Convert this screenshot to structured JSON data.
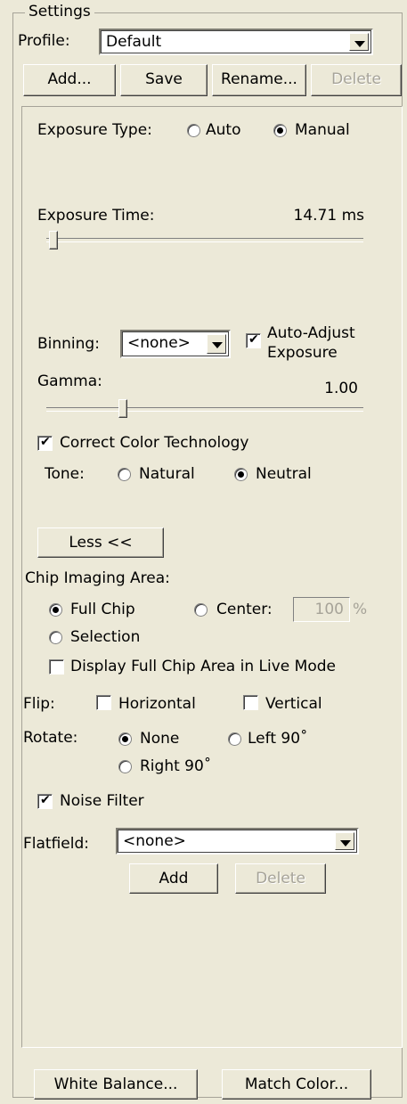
{
  "settings": {
    "group_title": "Settings",
    "profile_label": "Profile:",
    "profile_value": "Default",
    "buttons": {
      "add": "Add...",
      "save": "Save",
      "rename": "Rename...",
      "delete": "Delete"
    }
  },
  "exposure": {
    "type_label": "Exposure Type:",
    "auto_label": "Auto",
    "manual_label": "Manual",
    "selected": "Manual",
    "time_label": "Exposure Time:",
    "time_value": "14.71 ms",
    "time_slider_level": 0.02
  },
  "binning": {
    "label": "Binning:",
    "value": "<none>",
    "auto_adjust_label_1": "Auto-Adjust",
    "auto_adjust_label_2": "Exposure",
    "auto_adjust_checked": true
  },
  "gamma": {
    "label": "Gamma:",
    "value": "1.00",
    "slider_level": 0.25
  },
  "color": {
    "correct_label": "Correct Color Technology",
    "correct_checked": true,
    "tone_label": "Tone:",
    "natural_label": "Natural",
    "neutral_label": "Neutral",
    "selected": "Neutral"
  },
  "less_button": "Less <<",
  "chip": {
    "area_label": "Chip Imaging Area:",
    "full_chip_label": "Full Chip",
    "center_label": "Center:",
    "center_value": "100",
    "percent": "%",
    "selection_label": "Selection",
    "selected": "Full Chip",
    "display_full_label": "Display Full Chip Area in Live Mode",
    "display_full_checked": false
  },
  "flip": {
    "label": "Flip:",
    "horizontal_label": "Horizontal",
    "vertical_label": "Vertical"
  },
  "rotate": {
    "label": "Rotate:",
    "none_label": "None",
    "left_label": "Left 90˚",
    "right_label": "Right 90˚",
    "selected": "None"
  },
  "noise": {
    "label": "Noise Filter",
    "checked": true
  },
  "flatfield": {
    "label": "Flatfield:",
    "value": "<none>",
    "add": "Add",
    "delete": "Delete"
  },
  "footer": {
    "white_balance": "White Balance...",
    "match_color": "Match Color..."
  }
}
